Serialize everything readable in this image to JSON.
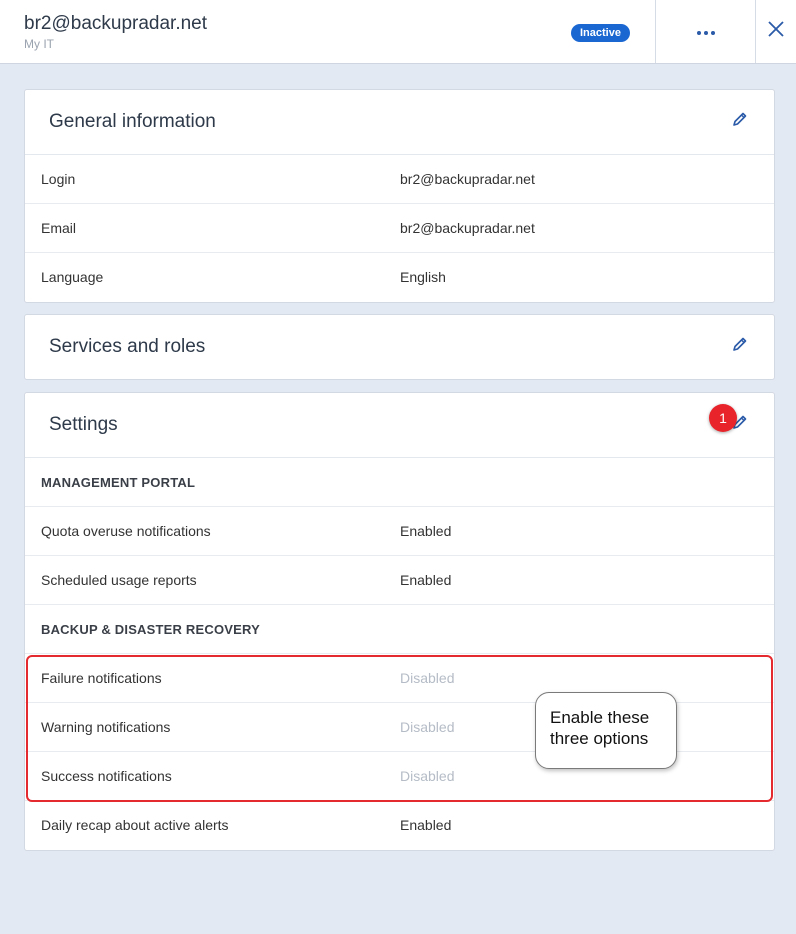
{
  "header": {
    "title": "br2@backupradar.net",
    "subtitle": "My IT",
    "status_badge": "Inactive"
  },
  "general": {
    "title": "General information",
    "rows": [
      {
        "label": "Login",
        "value": "br2@backupradar.net"
      },
      {
        "label": "Email",
        "value": "br2@backupradar.net"
      },
      {
        "label": "Language",
        "value": "English"
      }
    ]
  },
  "services": {
    "title": "Services and roles"
  },
  "settings": {
    "title": "Settings",
    "management_portal": {
      "heading": "MANAGEMENT PORTAL",
      "rows": [
        {
          "label": "Quota overuse notifications",
          "value": "Enabled"
        },
        {
          "label": "Scheduled usage reports",
          "value": "Enabled"
        }
      ]
    },
    "backup": {
      "heading": "BACKUP & DISASTER RECOVERY",
      "rows": [
        {
          "label": "Failure notifications",
          "value": "Disabled"
        },
        {
          "label": "Warning notifications",
          "value": "Disabled"
        },
        {
          "label": "Success notifications",
          "value": "Disabled"
        },
        {
          "label": "Daily recap about active alerts",
          "value": "Enabled"
        }
      ]
    }
  },
  "annotations": {
    "step_marker": "1",
    "callout_text": "Enable these three options"
  },
  "colors": {
    "accent": "#1a67d2",
    "background": "#e3e9f3",
    "annotation_red": "#e52a2f"
  },
  "icons": {
    "more": "more-horizontal-icon",
    "close": "close-icon",
    "edit": "pencil-icon"
  }
}
